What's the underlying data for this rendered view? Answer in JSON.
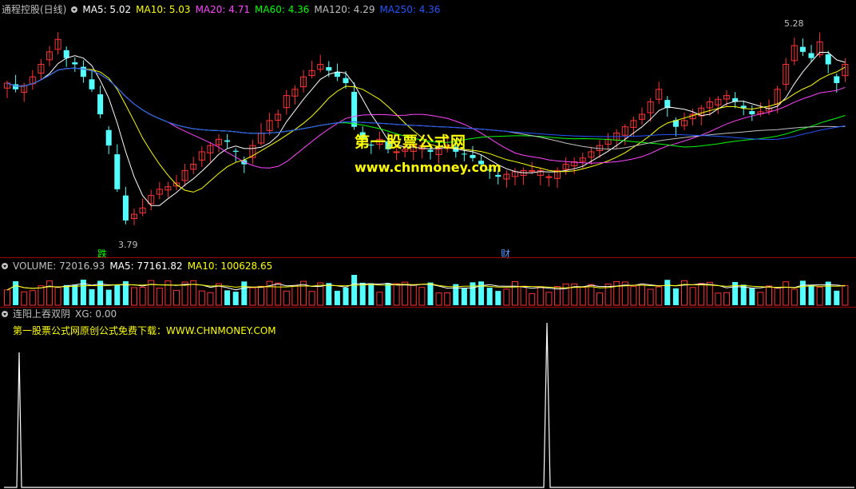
{
  "header": {
    "title": "通程控股(日线)",
    "ma": [
      {
        "label": "MA5: 5.02",
        "color": "#ffffff"
      },
      {
        "label": "MA10: 5.03",
        "color": "#ffff00"
      },
      {
        "label": "MA20: 4.71",
        "color": "#ff44ff"
      },
      {
        "label": "MA60: 4.36",
        "color": "#00ff00"
      },
      {
        "label": "MA120: 4.29",
        "color": "#c0c0c0"
      },
      {
        "label": "MA250: 4.36",
        "color": "#2255ff"
      }
    ]
  },
  "watermark": {
    "cn": "第一股票公式网",
    "url": "www.chnmoney.com"
  },
  "price_labels": {
    "high": "5.28",
    "low": "3.79",
    "die": "跌",
    "cai": "财"
  },
  "volume_header": {
    "label": "VOLUME: 72016.93",
    "ma5": "MA5: 77161.82",
    "ma10": "MA10: 100628.65"
  },
  "indicator_header": {
    "name": "连阳上吞双阴",
    "xg": "XG: 0.00"
  },
  "indicator_note": "第一股票公式网原创公式免费下载：WWW.CHNMONEY.COM",
  "colors": {
    "up": "#ff3232",
    "down": "#54ffff",
    "background": "#000000"
  },
  "chart_data": {
    "type": "candlestick",
    "approx_close": [
      4.95,
      4.9,
      4.93,
      5.0,
      5.1,
      5.2,
      5.3,
      5.15,
      5.1,
      5.0,
      4.9,
      4.7,
      4.45,
      4.1,
      3.85,
      3.9,
      3.95,
      4.05,
      4.1,
      4.12,
      4.15,
      4.25,
      4.3,
      4.4,
      4.45,
      4.5,
      4.48,
      4.4,
      4.3,
      4.45,
      4.55,
      4.65,
      4.7,
      4.85,
      4.9,
      5.0,
      5.05,
      5.1,
      5.05,
      5.0,
      4.95,
      4.6,
      4.5,
      4.45,
      4.5,
      4.42,
      4.4,
      4.42,
      4.45,
      4.45,
      4.4,
      4.42,
      4.45,
      4.4,
      4.38,
      4.35,
      4.3,
      4.25,
      4.2,
      4.22,
      4.24,
      4.25,
      4.25,
      4.25,
      4.2,
      4.25,
      4.3,
      4.32,
      4.35,
      4.4,
      4.45,
      4.5,
      4.55,
      4.6,
      4.65,
      4.7,
      4.8,
      4.9,
      4.75,
      4.6,
      4.65,
      4.7,
      4.75,
      4.8,
      4.82,
      4.85,
      4.8,
      4.75,
      4.7,
      4.72,
      4.75,
      4.9,
      5.1,
      5.25,
      5.2,
      5.15,
      5.28,
      5.1,
      4.95,
      5.1
    ]
  }
}
